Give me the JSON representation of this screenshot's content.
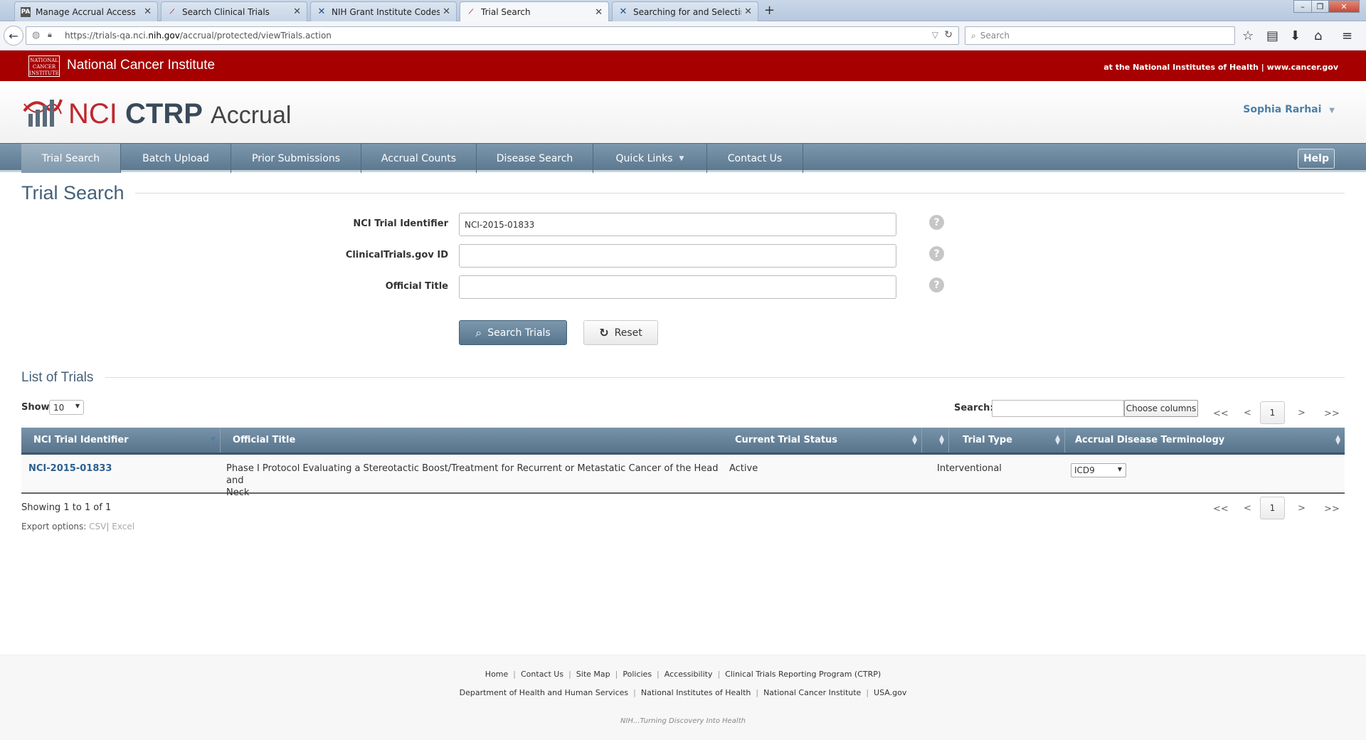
{
  "browser": {
    "tabs": [
      {
        "title": "Manage Accrual Access",
        "icon": "nci-favicon"
      },
      {
        "title": "Search Clinical Trials",
        "icon": "ctrp-favicon"
      },
      {
        "title": "NIH Grant Institute Codes ...",
        "icon": "x-favicon"
      },
      {
        "title": "Trial Search",
        "icon": "ctrp-favicon"
      },
      {
        "title": "Searching for and Selectin...",
        "icon": "x-favicon"
      }
    ],
    "url_prefix": "https://trials-qa.nci.",
    "url_domain": "nih.gov",
    "url_path": "/accrual/protected/viewTrials.action",
    "search_placeholder": "Search"
  },
  "banner": {
    "logo_lines": [
      "NATIONAL",
      "CANCER",
      "INSTITUTE"
    ],
    "name": "National Cancer Institute",
    "right_text": "at the National Institutes of Health | www.cancer.gov"
  },
  "header": {
    "brand_nci": "NCI",
    "brand_ctrp": "CTRP",
    "brand_accrual": "Accrual",
    "user_name": "Sophia Rarhai"
  },
  "nav": {
    "items": [
      "Trial Search",
      "Batch Upload",
      "Prior Submissions",
      "Accrual Counts",
      "Disease Search",
      "Quick Links",
      "Contact Us"
    ],
    "help": "Help"
  },
  "page": {
    "title": "Trial Search",
    "fields": [
      {
        "label": "NCI Trial Identifier",
        "value": "NCI-2015-01833"
      },
      {
        "label": "ClinicalTrials.gov ID",
        "value": ""
      },
      {
        "label": "Official Title",
        "value": ""
      }
    ],
    "search_button": "Search Trials",
    "reset_button": "Reset"
  },
  "list": {
    "title": "List of Trials",
    "show_label": "Show",
    "show_value": "10",
    "search_label": "Search:",
    "choose_columns": "Choose columns",
    "pager": {
      "first": "<<",
      "prev": "<",
      "page": "1",
      "next": ">",
      "last": ">>"
    },
    "columns": [
      "NCI Trial Identifier",
      "Official Title",
      "Current Trial Status",
      "Trial Type",
      "Accrual Disease Terminology"
    ],
    "rows": [
      {
        "id": "NCI-2015-01833",
        "title_line1": "Phase I Protocol Evaluating a Stereotactic Boost/Treatment for Recurrent or Metastatic Cancer of the Head and",
        "title_line2": "Neck",
        "status": "Active",
        "type": "Interventional",
        "terminology": "ICD9"
      }
    ],
    "showing": "Showing 1 to 1 of 1",
    "export_label": "Export options:",
    "export_csv": "CSV",
    "export_sep": "|",
    "export_excel": "Excel"
  },
  "footer": {
    "links1": [
      "Home",
      "Contact Us",
      "Site Map",
      "Policies",
      "Accessibility",
      "Clinical Trials Reporting Program (CTRP)"
    ],
    "links2": [
      "Department of Health and Human Services",
      "National Institutes of Health",
      "National Cancer Institute",
      "USA.gov"
    ],
    "tagline": "NIH...Turning Discovery Into Health"
  },
  "colors": {
    "banner_red": "#a70000",
    "nav_blue": "#5c7990",
    "link_blue": "#2a5f8f",
    "title_blue": "#45607a"
  }
}
